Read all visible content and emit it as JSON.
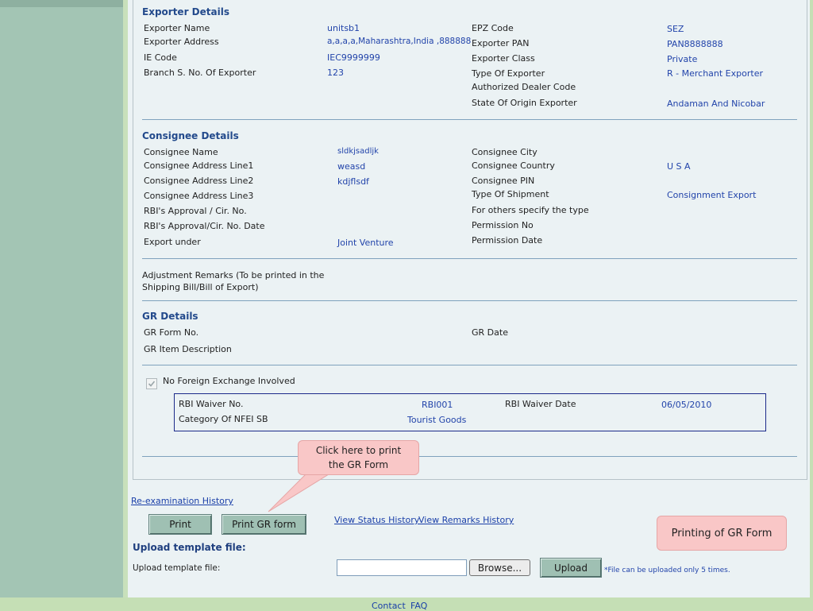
{
  "exporter": {
    "title": "Exporter Details",
    "left": [
      {
        "label": "Exporter Name",
        "value": "unitsb1"
      },
      {
        "label": "Exporter Address",
        "value": "a,a,a,a,Maharashtra,India ,888888"
      },
      {
        "label": "IE Code",
        "value": "IEC9999999"
      },
      {
        "label": "Branch S. No. Of Exporter",
        "value": "123"
      }
    ],
    "right": [
      {
        "label": "EPZ Code",
        "value": "SEZ"
      },
      {
        "label": "Exporter PAN",
        "value": "PAN8888888"
      },
      {
        "label": "Exporter Class",
        "value": "Private"
      },
      {
        "label": "Type Of Exporter",
        "value": "R - Merchant Exporter"
      },
      {
        "label": "Authorized Dealer Code",
        "value": ""
      },
      {
        "label": "State Of Origin Exporter",
        "value": "Andaman And Nicobar"
      }
    ]
  },
  "consignee": {
    "title": "Consignee Details",
    "left": [
      {
        "label": "Consignee Name",
        "value": "sldkjsadljk"
      },
      {
        "label": "Consignee Address Line1",
        "value": "weasd"
      },
      {
        "label": "Consignee Address Line2",
        "value": "kdjflsdf"
      },
      {
        "label": "Consignee Address Line3",
        "value": ""
      },
      {
        "label": "RBI's Approval / Cir. No.",
        "value": ""
      },
      {
        "label": "RBI's Approval/Cir. No. Date",
        "value": ""
      },
      {
        "label": "Export under",
        "value": "Joint Venture"
      }
    ],
    "right": [
      {
        "label": "Consignee City",
        "value": ""
      },
      {
        "label": "Consignee Country",
        "value": "U S A"
      },
      {
        "label": "Consignee PIN",
        "value": ""
      },
      {
        "label": "Type Of Shipment",
        "value": "Consignment Export"
      },
      {
        "label": "For others specify the type",
        "value": ""
      },
      {
        "label": "Permission No",
        "value": ""
      },
      {
        "label": "Permission Date",
        "value": ""
      }
    ]
  },
  "adjustment": {
    "line1": "Adjustment Remarks (To be printed in the",
    "line2": "Shipping Bill/Bill of Export)"
  },
  "gr": {
    "title": "GR Details",
    "form_no_label": "GR Form No.",
    "date_label": "GR Date",
    "item_desc_label": "GR Item Description"
  },
  "nfe": {
    "checkbox_label": "No Foreign Exchange Involved",
    "checked": true,
    "waiver_no_label": "RBI Waiver No.",
    "waiver_no_value": "RBI001",
    "waiver_date_label": "RBI Waiver Date",
    "waiver_date_value": "06/05/2010",
    "category_label": "Category Of NFEI SB",
    "category_value": "Tourist Goods"
  },
  "callout_print": {
    "line1": "Click here to print",
    "line2": "the GR Form"
  },
  "callout_title": "Printing of GR Form",
  "links": {
    "reexam": "Re-examination History",
    "status": "View Status History",
    "remarks": "View Remarks History"
  },
  "buttons": {
    "print": "Print",
    "print_gr": "Print GR form",
    "browse": "Browse...",
    "upload": "Upload"
  },
  "upload": {
    "heading": "Upload template file:",
    "label": "Upload template file:",
    "note": "*File can be uploaded only 5 times."
  },
  "footer": {
    "contact": "Contact",
    "faq": "FAQ"
  },
  "colors": {
    "accent": "#234a8c",
    "value": "#2244aa",
    "sidebar": "#a3c5b4",
    "callout": "#f9c7c7"
  }
}
